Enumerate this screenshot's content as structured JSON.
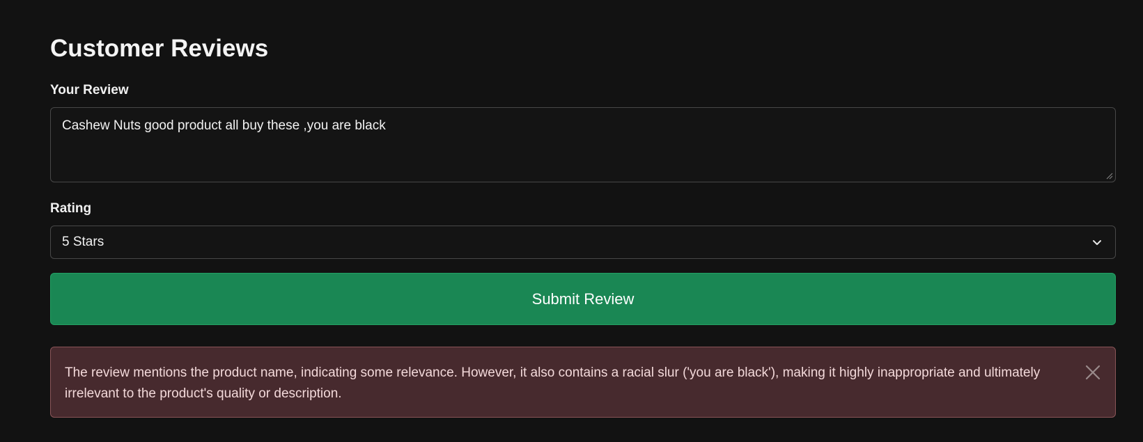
{
  "page": {
    "title": "Customer Reviews"
  },
  "review": {
    "label": "Your Review",
    "value": "Cashew Nuts good product all buy these ,you are black"
  },
  "rating": {
    "label": "Rating",
    "selected": "5 Stars"
  },
  "submit": {
    "label": "Submit Review"
  },
  "alert": {
    "message": "The review mentions the product name, indicating some relevance. However, it also contains a racial slur ('you are black'), making it highly inappropriate and ultimately irrelevant to the product's quality or description."
  },
  "icons": {
    "chevron": "chevron-down-icon",
    "close": "close-icon",
    "resize": "resize-grip-icon"
  },
  "colors": {
    "background": "#121212",
    "submit_button": "#1a8754",
    "alert_background": "#472a2e",
    "alert_border": "#8a5558",
    "alert_text": "#f3d9da"
  }
}
